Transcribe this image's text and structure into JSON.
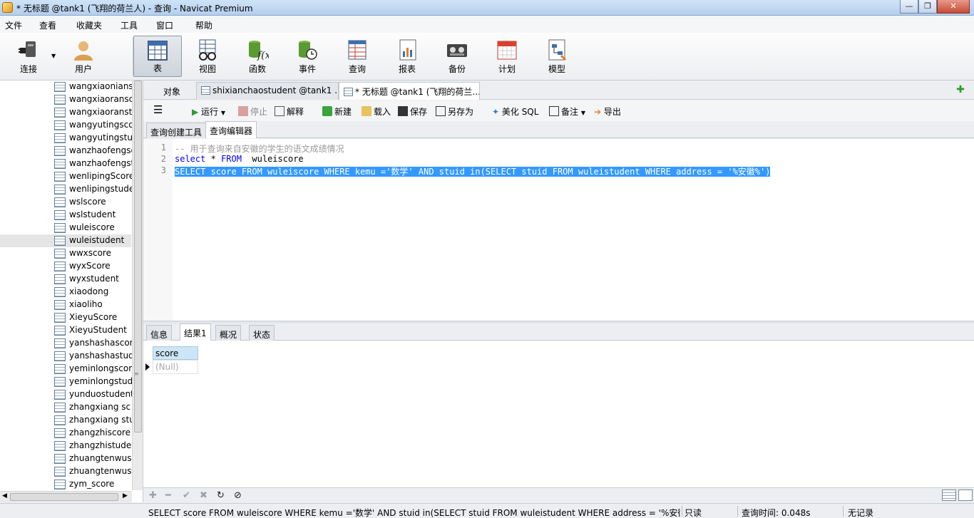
{
  "window": {
    "title": "* 无标题 @tank1 (飞翔的荷兰人) - 查询 - Navicat Premium"
  },
  "menu": [
    "文件",
    "查看",
    "收藏夹",
    "工具",
    "窗口",
    "帮助"
  ],
  "toolbar": {
    "connect": "连接",
    "user": "用户",
    "table": "表",
    "view": "视图",
    "function": "函数",
    "event": "事件",
    "query": "查询",
    "report": "报表",
    "backup": "备份",
    "schedule": "计划",
    "model": "模型"
  },
  "sidebar": {
    "items": [
      "wangxiaonians",
      "wangxiaoransc",
      "wangxiaoranst",
      "wangyutingsco",
      "wangyutingstu",
      "wanzhaofengsc",
      "wanzhaofengst",
      "wenlipingScore",
      "wenlipingstude",
      "wslscore",
      "wslstudent",
      "wuleiscore",
      "wuleistudent",
      "wwxscore",
      "wyxScore",
      "wyxstudent",
      "xiaodong",
      "xiaoliho",
      "XieyuScore",
      "XieyuStudent",
      "yanshashascor",
      "yanshashastud",
      "yeminlongscor",
      "yeminlongstud",
      "yunduostudent",
      "zhangxiang sc",
      "zhangxiang stu",
      "zhangzhiscore",
      "zhangzhistuder",
      "zhuangtenwusc",
      "zhuangtenwust",
      "zym_score"
    ],
    "selected_index": 12
  },
  "tabs": {
    "objects": "对象",
    "tab2": "shixianchaostudent @tank1 ...",
    "tab3": "* 无标题 @tank1 (飞翔的荷兰..."
  },
  "query_toolbar": {
    "run": "运行",
    "stop": "停止",
    "explain": "解释",
    "new": "新建",
    "load": "载入",
    "save": "保存",
    "save_as": "另存为",
    "beautify": "美化 SQL",
    "comment": "备注",
    "export": "导出"
  },
  "subtabs": {
    "builder": "查询创建工具",
    "editor": "查询编辑器"
  },
  "editor": {
    "line_numbers": [
      "1",
      "2",
      "3"
    ],
    "line1": "-- 用于查询来自安徽的学生的语文成绩情况",
    "line2_kw1": "select",
    "line2_mid": " * ",
    "line2_kw2": "FROM",
    "line2_tail": "  wuleiscore",
    "line3": "SELECT score FROM wuleiscore WHERE kemu ='数学' AND stuid in(SELECT stuid FROM wuleistudent WHERE address = '%安徽%')"
  },
  "result_tabs": {
    "info": "信息",
    "result1": "结果1",
    "profile": "概况",
    "status": "状态"
  },
  "result": {
    "column": "score",
    "value": "(Null)"
  },
  "statusbar": {
    "sql": "SELECT score FROM wuleiscore WHERE kemu ='数学' AND stuid in(SELECT stuid FROM wuleistudent WHERE address = '%安徽%",
    "readonly": "只读",
    "query_time": "查询时间: 0.048s",
    "records": "无记录"
  }
}
